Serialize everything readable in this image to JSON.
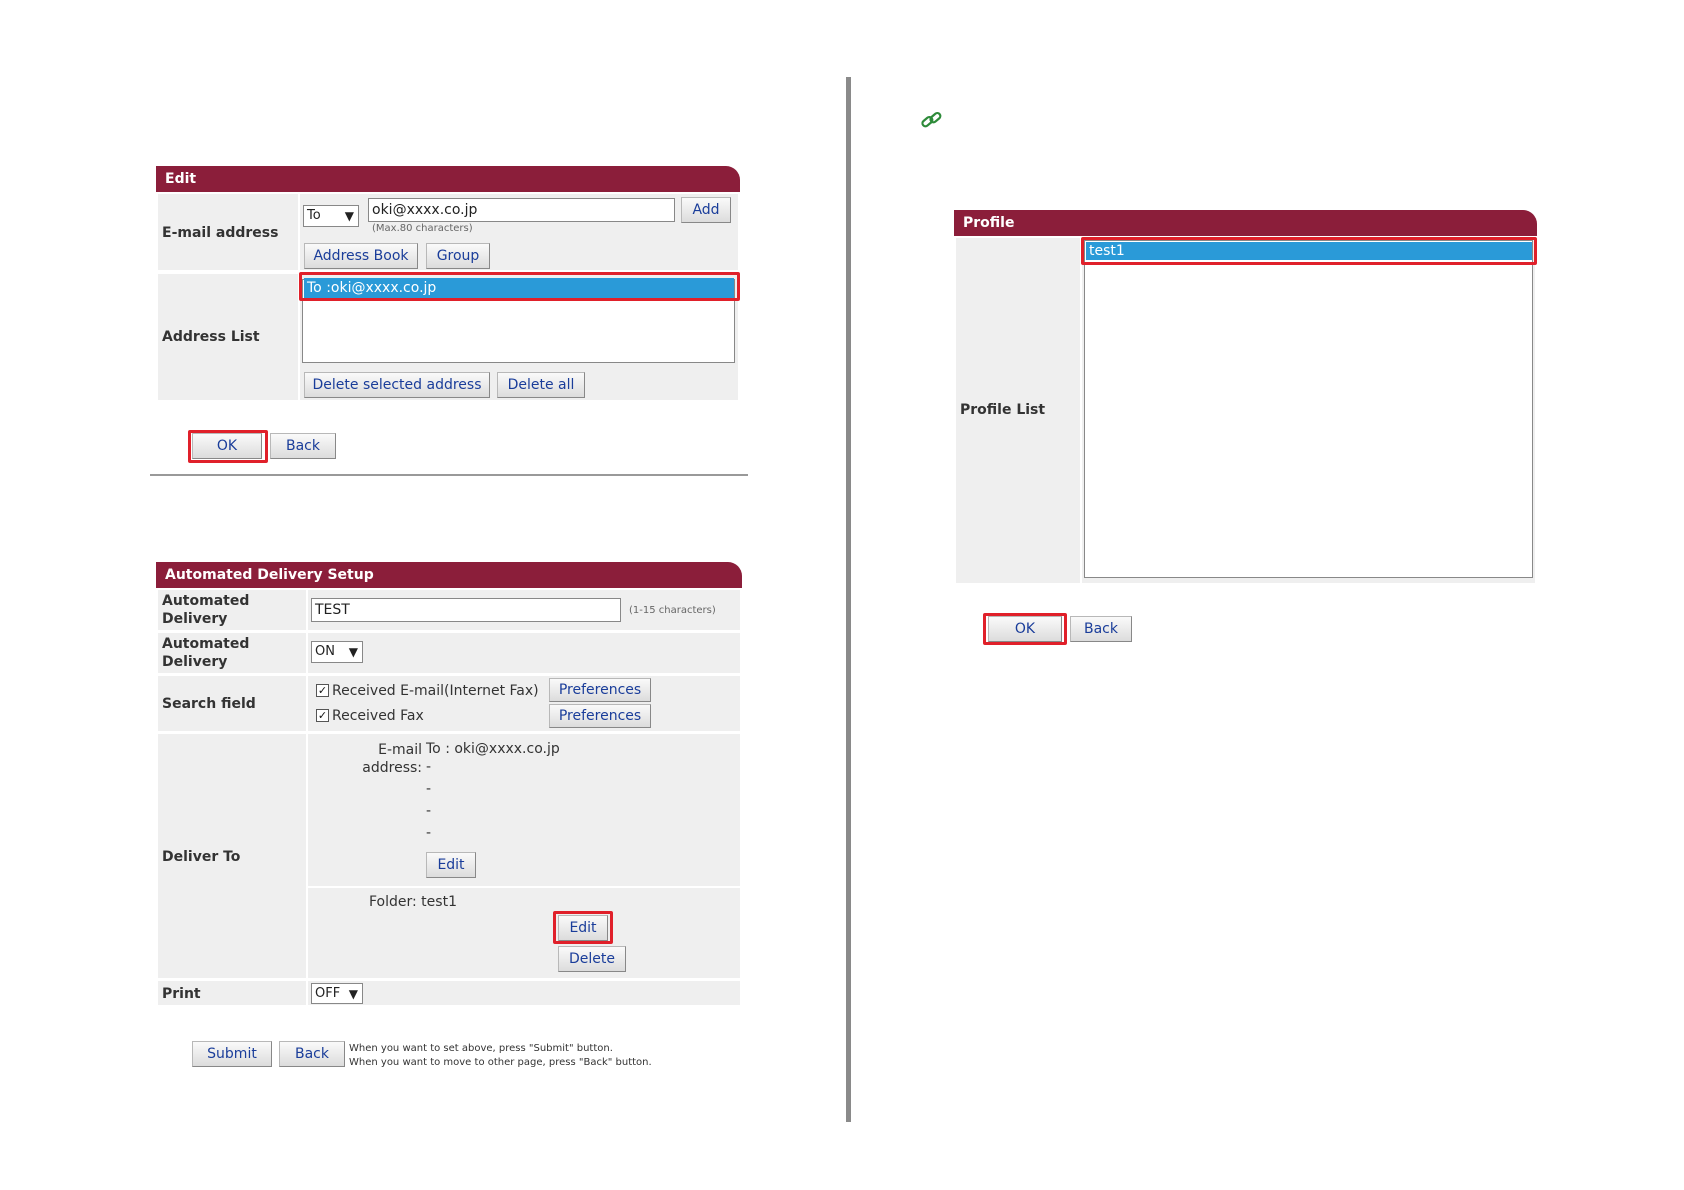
{
  "edit": {
    "title": "Edit",
    "email_label": "E-mail address",
    "to_select": "To",
    "email_value": "oki@xxxx.co.jp",
    "add": "Add",
    "max_hint": "(Max.80 characters)",
    "address_book": "Address Book",
    "group": "Group",
    "address_list_label": "Address List",
    "selected_address": "To :oki@xxxx.co.jp",
    "delete_selected": "Delete selected address",
    "delete_all": "Delete all",
    "ok": "OK",
    "back": "Back"
  },
  "delivery": {
    "title": "Automated Delivery Setup",
    "row1_label": "Automated Delivery",
    "name_value": "TEST",
    "name_hint": "(1-15 characters)",
    "row2_label": "Automated Delivery",
    "onoff_value": "ON",
    "search_label": "Search field",
    "check1_label": "Received E-mail(Internet Fax)",
    "check2_label": "Received Fax",
    "preferences": "Preferences",
    "deliver_label": "Deliver To",
    "email_label": "E-mail address:",
    "email_to": "To : oki@xxxx.co.jp",
    "dash": "-",
    "edit": "Edit",
    "folder_text": "Folder: test1",
    "delete": "Delete",
    "print_label": "Print",
    "print_value": "OFF",
    "submit": "Submit",
    "back": "Back",
    "note1": "When you want to set above, press \"Submit\" button.",
    "note2": "When you want to move to other page, press \"Back\" button."
  },
  "profile": {
    "title": "Profile",
    "list_label": "Profile List",
    "selected_item": "test1",
    "ok": "OK",
    "back": "Back"
  },
  "colors": {
    "header": "#8b1e3a",
    "highlight": "#e0202a",
    "selection": "#2a9ad8",
    "link_icon": "#2e8b3a"
  }
}
